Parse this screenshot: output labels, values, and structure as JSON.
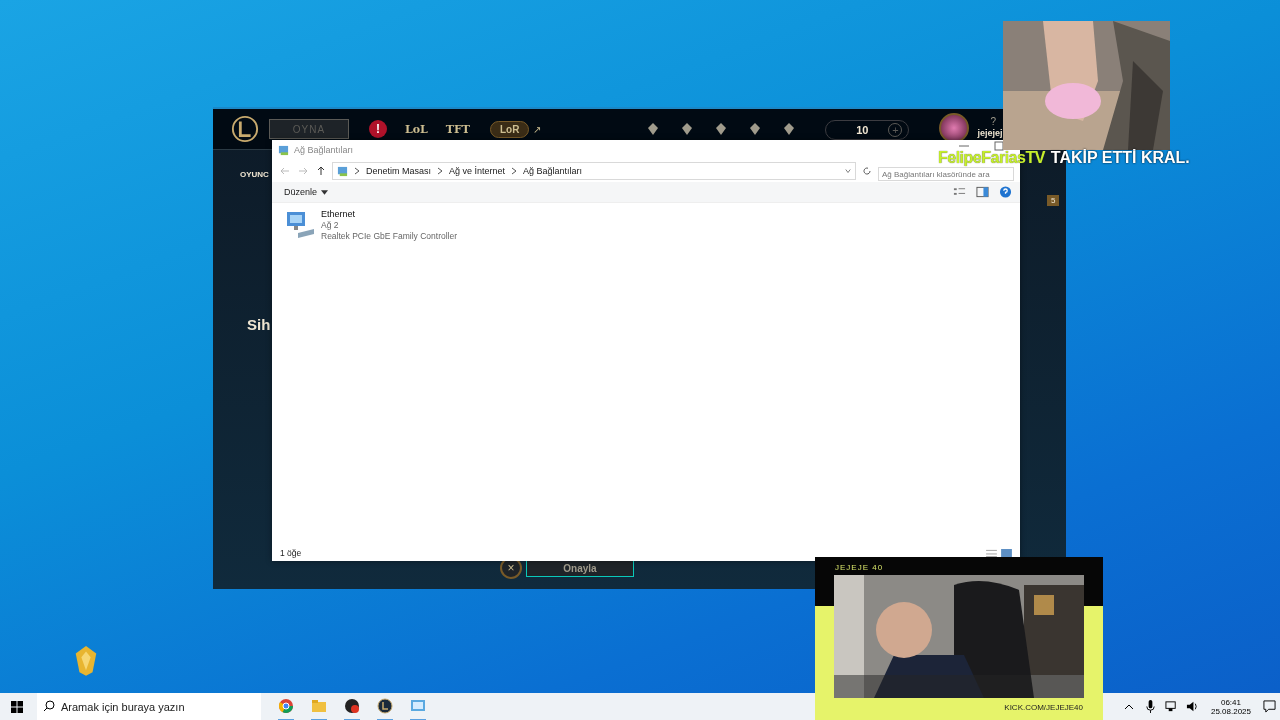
{
  "game_client": {
    "play_button": "OYNA",
    "alert": "!",
    "nav": [
      {
        "label": "LoL",
        "kind": "text"
      },
      {
        "label": "TFT",
        "kind": "text"
      },
      {
        "label": "LoR",
        "kind": "pill"
      }
    ],
    "external": "↗",
    "currency": "10",
    "currency_add": "+",
    "username": "jejejej",
    "help": "?",
    "side_tab": "OYUNC",
    "heading": "Sih",
    "confirm_button": "Onayla",
    "cancel": "×",
    "badge": "5"
  },
  "explorer": {
    "title": "Ağ Bağlantıları",
    "breadcrumb": [
      "Denetim Masası",
      "Ağ ve İnternet",
      "Ağ Bağlantıları"
    ],
    "search": {
      "placeholder": "Ağ Bağlantıları klasöründe ara"
    },
    "organize": "Düzenle",
    "items": [
      {
        "name": "Ethernet",
        "network": "Ağ 2",
        "device": "Realtek PCIe GbE Family Controller"
      }
    ],
    "status": "1 öğe"
  },
  "follow_alert": {
    "name": "FelipeFariasTV",
    "message": "TAKİP ETTİ KRAL."
  },
  "webcam": {
    "title": "JEJEJE 40",
    "url": "KICK.COM/JEJEJE40"
  },
  "taskbar": {
    "search": {
      "placeholder": "Aramak için buraya yazın"
    },
    "time": "06:41",
    "date": "25.08.2025"
  }
}
